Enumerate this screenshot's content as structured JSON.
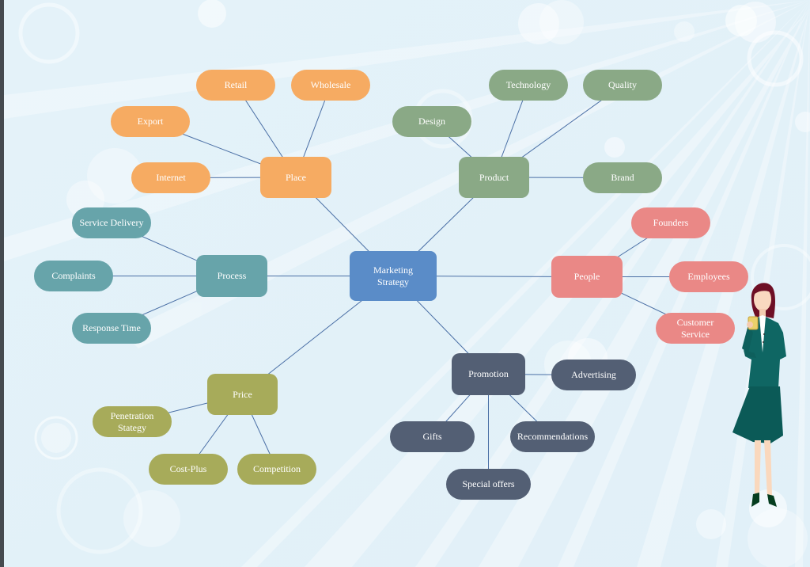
{
  "diagram": {
    "title": "Marketing Strategy",
    "center": {
      "label_lines": [
        "Marketing",
        "Strategy"
      ],
      "color": "#5a8cc8"
    },
    "branches": [
      {
        "id": "place",
        "label": "Place",
        "color": "#f6ab62",
        "children": [
          "Retail",
          "Wholesale",
          "Export",
          "Internet"
        ]
      },
      {
        "id": "product",
        "label": "Product",
        "color": "#8aa986",
        "children": [
          "Technology",
          "Quality",
          "Design",
          "Brand"
        ]
      },
      {
        "id": "process",
        "label": "Process",
        "color": "#67a4aa",
        "children": [
          "Service Delivery",
          "Complaints",
          "Response Time"
        ]
      },
      {
        "id": "people",
        "label": "People",
        "color": "#ea8886",
        "children": [
          "Founders",
          "Employees",
          "Customer Service"
        ]
      },
      {
        "id": "price",
        "label": "Price",
        "color": "#a7ab5a",
        "children": [
          "Penetration Stategy",
          "Cost-Plus",
          "Competition"
        ]
      },
      {
        "id": "promotion",
        "label": "Promotion",
        "color": "#535f74",
        "children": [
          "Advertising",
          "Gifts",
          "Recommendations",
          "Special offers"
        ]
      }
    ],
    "link_color": "#4a6fa5",
    "illustration": "businesswoman-holding-cup"
  }
}
